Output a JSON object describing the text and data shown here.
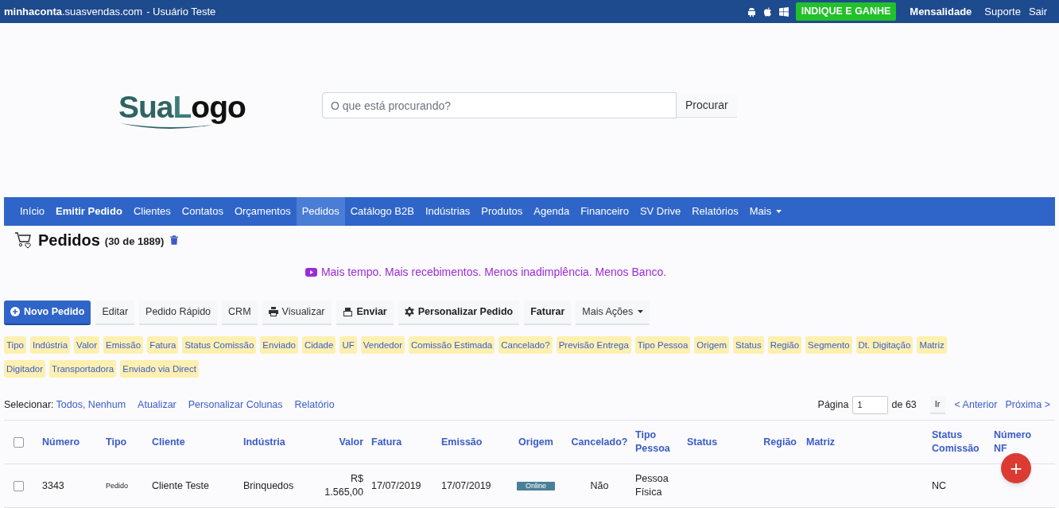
{
  "top_bar": {
    "site": "minhaconta",
    "domain": ".suasvendas.com",
    "user": "- Usuário Teste",
    "promo_button": "INDIQUE E GANHE",
    "links": [
      {
        "label": "Mensalidade",
        "bold": true
      },
      {
        "label": "Suporte",
        "bold": false
      },
      {
        "label": "Sair",
        "bold": false
      }
    ]
  },
  "logo": {
    "parts": [
      "Sua",
      "L",
      "ogo"
    ]
  },
  "search": {
    "placeholder": "O que está procurando?",
    "button": "Procurar"
  },
  "nav": [
    {
      "label": "Início",
      "selected": false,
      "bold": false
    },
    {
      "label": "Emitir Pedido",
      "selected": false,
      "bold": true
    },
    {
      "label": "Clientes",
      "selected": false,
      "bold": false
    },
    {
      "label": "Contatos",
      "selected": false,
      "bold": false
    },
    {
      "label": "Orçamentos",
      "selected": false,
      "bold": false
    },
    {
      "label": "Pedidos",
      "selected": true,
      "bold": false
    },
    {
      "label": "Catálogo B2B",
      "selected": false,
      "bold": false
    },
    {
      "label": "Indústrias",
      "selected": false,
      "bold": false
    },
    {
      "label": "Produtos",
      "selected": false,
      "bold": false
    },
    {
      "label": "Agenda",
      "selected": false,
      "bold": false
    },
    {
      "label": "Financeiro",
      "selected": false,
      "bold": false
    },
    {
      "label": "SV Drive",
      "selected": false,
      "bold": false
    },
    {
      "label": "Relatórios",
      "selected": false,
      "bold": false
    },
    {
      "label": "Mais",
      "selected": false,
      "bold": false,
      "dropdown": true
    }
  ],
  "page": {
    "title": "Pedidos",
    "count": "(30 de 1889)"
  },
  "announcement": "Mais tempo. Mais recebimentos. Menos inadimplência. Menos Banco.",
  "actions": [
    {
      "label": "Novo Pedido",
      "kind": "primary"
    },
    {
      "label": "Editar",
      "kind": "plain"
    },
    {
      "label": "Pedido Rápido",
      "kind": "plain"
    },
    {
      "label": "CRM",
      "kind": "plain"
    },
    {
      "label": "Visualizar",
      "kind": "plain"
    },
    {
      "label": "Enviar",
      "kind": "bold"
    },
    {
      "label": "Personalizar Pedido",
      "kind": "bold"
    },
    {
      "label": "Faturar",
      "kind": "bold"
    },
    {
      "label": "Mais Ações",
      "kind": "dropdown"
    }
  ],
  "filters": [
    "Tipo",
    "Indústria",
    "Valor",
    "Emissão",
    "Fatura",
    "Status Comissão",
    "Enviado",
    "Cidade",
    "UF",
    "Vendedor",
    "Comissão Estimada",
    "Cancelado?",
    "Previsão Entrega",
    "Tipo Pessoa",
    "Origem",
    "Status",
    "Região",
    "Segmento",
    "Dt. Digitação",
    "Matriz",
    "Digitador",
    "Transportadora",
    "Enviado via Direct"
  ],
  "toolbar": {
    "select_label": "Selecionar:",
    "select_links": "Todos, Nenhum",
    "links": [
      "Atualizar",
      "Personalizar Colunas",
      "Relatório"
    ],
    "page_label": "Página",
    "page_value": "1",
    "page_total": "de 63",
    "go": "Ir",
    "prev": "< Anterior",
    "next": "Próxima >"
  },
  "table": {
    "select_all_checked": false,
    "columns": [
      "Número",
      "Tipo",
      "Cliente",
      "Indústria",
      "Valor",
      "Fatura",
      "Emissão",
      "Origem",
      "Cancelado?",
      "Tipo Pessoa",
      "Status",
      "Região",
      "Matriz",
      "Status Comissão",
      "Número NF"
    ],
    "rows": [
      {
        "checked": false,
        "cells": [
          "3343",
          "Pedido",
          "Cliente Teste",
          "Brinquedos",
          "R$ 1.565,00",
          "17/07/2019",
          "17/07/2019",
          "Online",
          "Não",
          "Pessoa Física",
          "",
          "",
          "",
          "NC",
          ""
        ]
      }
    ]
  },
  "fab": "+"
}
